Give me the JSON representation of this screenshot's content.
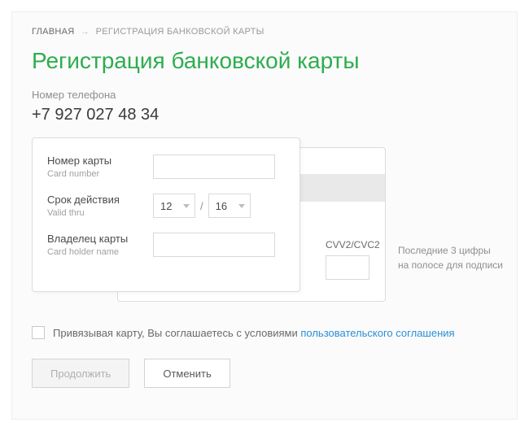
{
  "breadcrumb": {
    "home": "ГЛАВНАЯ",
    "arrow": "→",
    "current": "РЕГИСТРАЦИЯ БАНКОВСКОЙ КАРТЫ"
  },
  "title": "Регистрация банковской карты",
  "phone": {
    "label": "Номер телефона",
    "value": "+7 927 027 48 34"
  },
  "card": {
    "number": {
      "ru": "Номер карты",
      "en": "Card number"
    },
    "expiry": {
      "ru": "Срок действия",
      "en": "Valid thru",
      "month": "12",
      "slash": "/",
      "year": "16"
    },
    "holder": {
      "ru": "Владелец карты",
      "en": "Card holder name"
    },
    "cvv": {
      "label": "CVV2/CVC2",
      "hint1": "Последние 3 цифры",
      "hint2": "на полосе для подписи"
    }
  },
  "agreement": {
    "text": "Привязывая карту, Вы соглашаетесь с условиями ",
    "link": "пользовательского соглашения"
  },
  "buttons": {
    "continue": "Продолжить",
    "cancel": "Отменить"
  }
}
